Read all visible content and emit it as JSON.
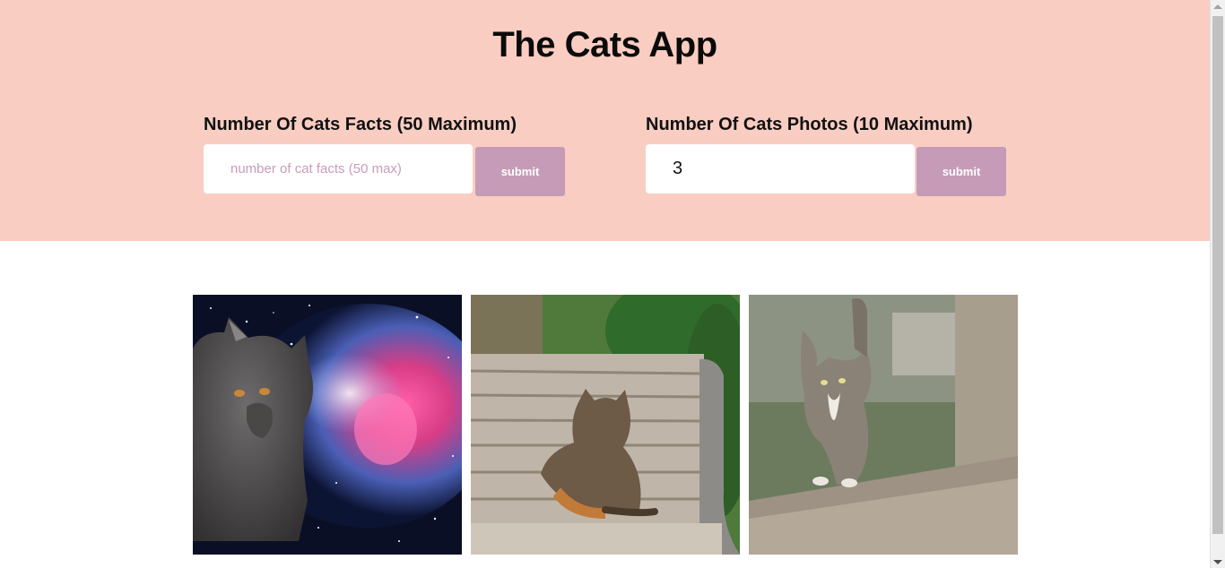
{
  "app_title": "The Cats App",
  "facts_form": {
    "label": "Number Of Cats Facts (50 Maximum)",
    "placeholder": "number of cat facts (50 max)",
    "value": "",
    "submit_label": "submit"
  },
  "photos_form": {
    "label": "Number Of Cats Photos (10 Maximum)",
    "value": "3",
    "submit_label": "submit"
  },
  "photos": [
    {
      "icon": "cat-in-space-photo"
    },
    {
      "icon": "cat-on-bench-photo"
    },
    {
      "icon": "kitten-walking-photo"
    }
  ],
  "colors": {
    "header_bg": "#facdc2",
    "button_bg": "#c69bb8",
    "placeholder": "#c99cbb"
  }
}
